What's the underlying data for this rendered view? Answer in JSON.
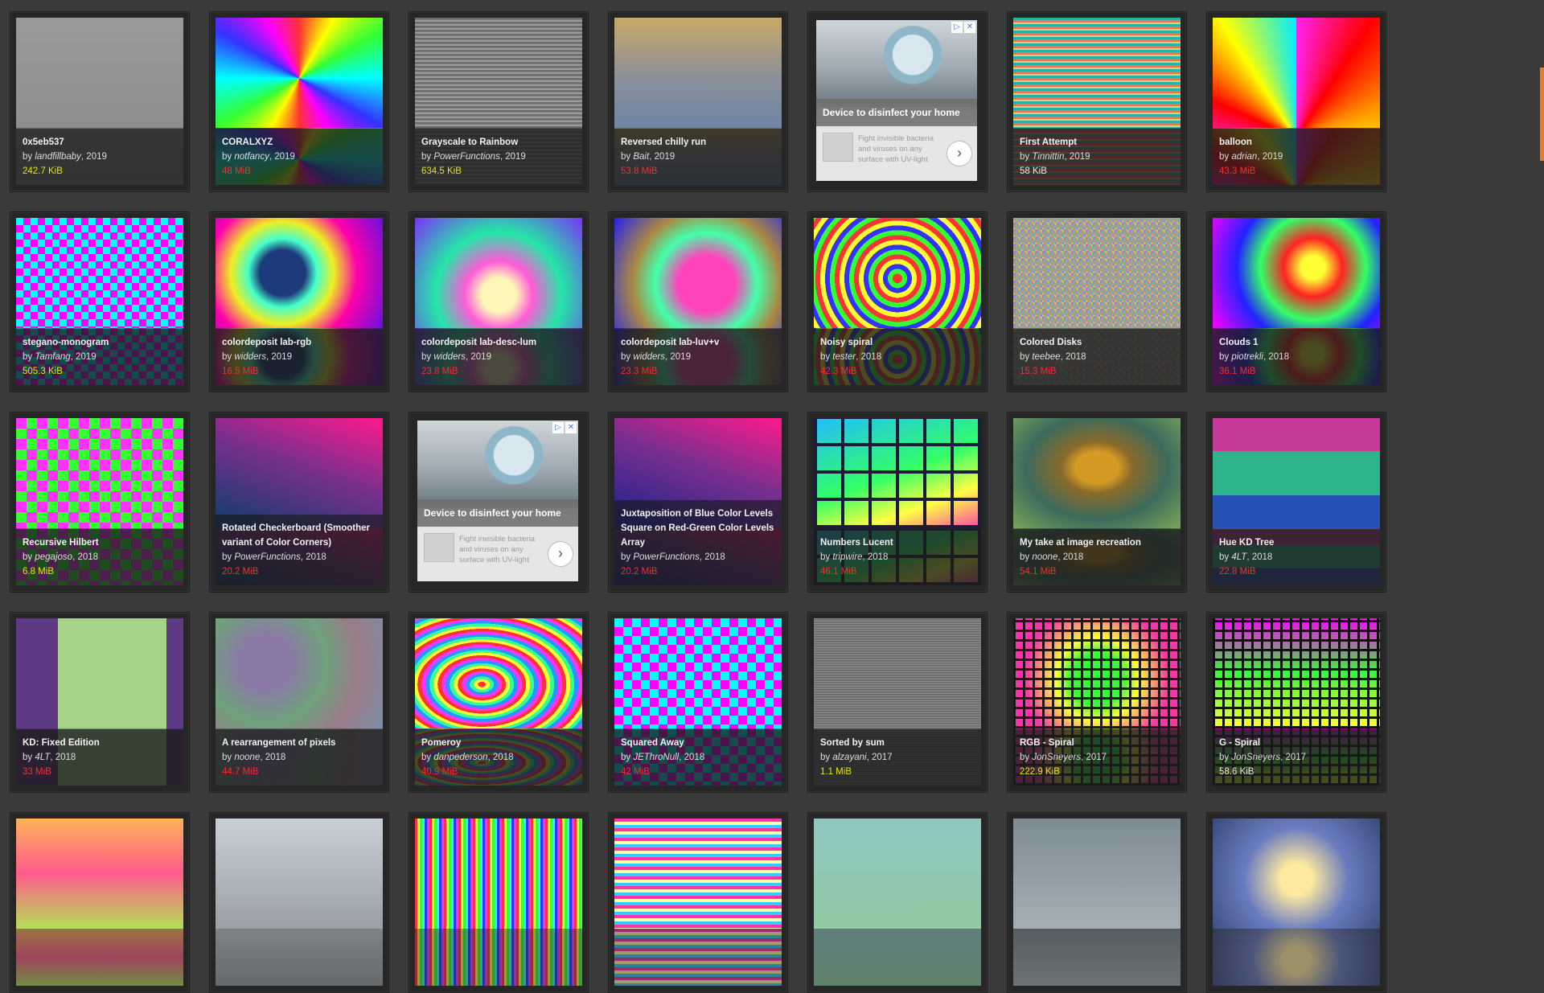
{
  "colors": {
    "size_green": "#e6e600",
    "size_red": "#ff2a2a",
    "size_white": "#e8e8e8",
    "scroll_accent": "#f07b1e"
  },
  "ad": {
    "headline": "Device to disinfect your home",
    "body": "Fight invisible bacteria and viruses on any surface with UV-light",
    "adchoices_icon": "adchoices-icon",
    "close_icon": "close-icon",
    "arrow_icon": "chevron-right-icon"
  },
  "cards": [
    {
      "title": "0x5eb537",
      "by": "by",
      "author": "landfillbaby",
      "year": "2019",
      "size": "242.7 KiB",
      "size_color": "green"
    },
    {
      "title": "CORALXYZ",
      "by": "by",
      "author": "notfancy",
      "year": "2019",
      "size": "48 MiB",
      "size_color": "red"
    },
    {
      "title": "Grayscale to Rainbow",
      "by": "by",
      "author": "PowerFunctions",
      "year": "2019",
      "size": "634.5 KiB",
      "size_color": "green"
    },
    {
      "title": "Reversed chilly run",
      "by": "by",
      "author": "Bait",
      "year": "2019",
      "size": "53.8 MiB",
      "size_color": "red"
    },
    {
      "ad": true
    },
    {
      "title": "First Attempt",
      "by": "by",
      "author": "Tinnittin",
      "year": "2019",
      "size": "58 KiB",
      "size_color": "white"
    },
    {
      "title": "balloon",
      "by": "by",
      "author": "adrian",
      "year": "2019",
      "size": "43.3 MiB",
      "size_color": "red"
    },
    {
      "title": "stegano-monogram",
      "by": "by",
      "author": "Tamfang",
      "year": "2019",
      "size": "505.3 KiB",
      "size_color": "green"
    },
    {
      "title": "colordeposit lab-rgb",
      "by": "by",
      "author": "widders",
      "year": "2019",
      "size": "16.5 MiB",
      "size_color": "red"
    },
    {
      "title": "colordeposit lab-desc-lum",
      "by": "by",
      "author": "widders",
      "year": "2019",
      "size": "23.8 MiB",
      "size_color": "red"
    },
    {
      "title": "colordeposit lab-luv+v",
      "by": "by",
      "author": "widders",
      "year": "2019",
      "size": "23.3 MiB",
      "size_color": "red"
    },
    {
      "title": "Noisy spiral",
      "by": "by",
      "author": "tester",
      "year": "2018",
      "size": "42.3 MiB",
      "size_color": "red"
    },
    {
      "title": "Colored Disks",
      "by": "by",
      "author": "teebee",
      "year": "2018",
      "size": "15.3 MiB",
      "size_color": "red"
    },
    {
      "title": "Clouds 1",
      "by": "by",
      "author": "piotrekli",
      "year": "2018",
      "size": "36.1 MiB",
      "size_color": "red"
    },
    {
      "title": "Recursive Hilbert",
      "by": "by",
      "author": "pegajoso",
      "year": "2018",
      "size": "6.8 MiB",
      "size_color": "green"
    },
    {
      "title": "Rotated Checkerboard (Smoother variant of Color Corners)",
      "by": "by",
      "author": "PowerFunctions",
      "year": "2018",
      "size": "20.2 MiB",
      "size_color": "red"
    },
    {
      "ad": true
    },
    {
      "title": "Juxtaposition of Blue Color Levels Square on Red-Green Color Levels Array",
      "by": "by",
      "author": "PowerFunctions",
      "year": "2018",
      "size": "20.2 MiB",
      "size_color": "red"
    },
    {
      "title": "Numbers Lucent",
      "by": "by",
      "author": "tripwire",
      "year": "2018",
      "size": "46.1 MiB",
      "size_color": "red"
    },
    {
      "title": "My take at image recreation",
      "by": "by",
      "author": "noone",
      "year": "2018",
      "size": "54.1 MiB",
      "size_color": "red"
    },
    {
      "title": "Hue KD Tree",
      "by": "by",
      "author": "4LT",
      "year": "2018",
      "size": "22.8 MiB",
      "size_color": "red"
    },
    {
      "title": "KD: Fixed Edition",
      "by": "by",
      "author": "4LT",
      "year": "2018",
      "size": "33 MiB",
      "size_color": "red"
    },
    {
      "title": "A rearrangement of pixels",
      "by": "by",
      "author": "noone",
      "year": "2018",
      "size": "44.7 MiB",
      "size_color": "red"
    },
    {
      "title": "Pomeroy",
      "by": "by",
      "author": "danpederson",
      "year": "2018",
      "size": "40.9 MiB",
      "size_color": "red"
    },
    {
      "title": "Squared Away",
      "by": "by",
      "author": "JEThroNull",
      "year": "2018",
      "size": "42 MiB",
      "size_color": "red"
    },
    {
      "title": "Sorted by sum",
      "by": "by",
      "author": "alzayani",
      "year": "2017",
      "size": "1.1 MiB",
      "size_color": "green"
    },
    {
      "title": "RGB - Spiral",
      "by": "by",
      "author": "JonSneyers",
      "year": "2017",
      "size": "222.9 KiB",
      "size_color": "green"
    },
    {
      "title": "G - Spiral",
      "by": "by",
      "author": "JonSneyers",
      "year": "2017",
      "size": "58.6 KiB",
      "size_color": "white"
    },
    {
      "partial": true
    },
    {
      "partial": true
    },
    {
      "partial": true
    },
    {
      "partial": true
    },
    {
      "partial": true
    },
    {
      "partial": true
    },
    {
      "partial": true
    }
  ]
}
